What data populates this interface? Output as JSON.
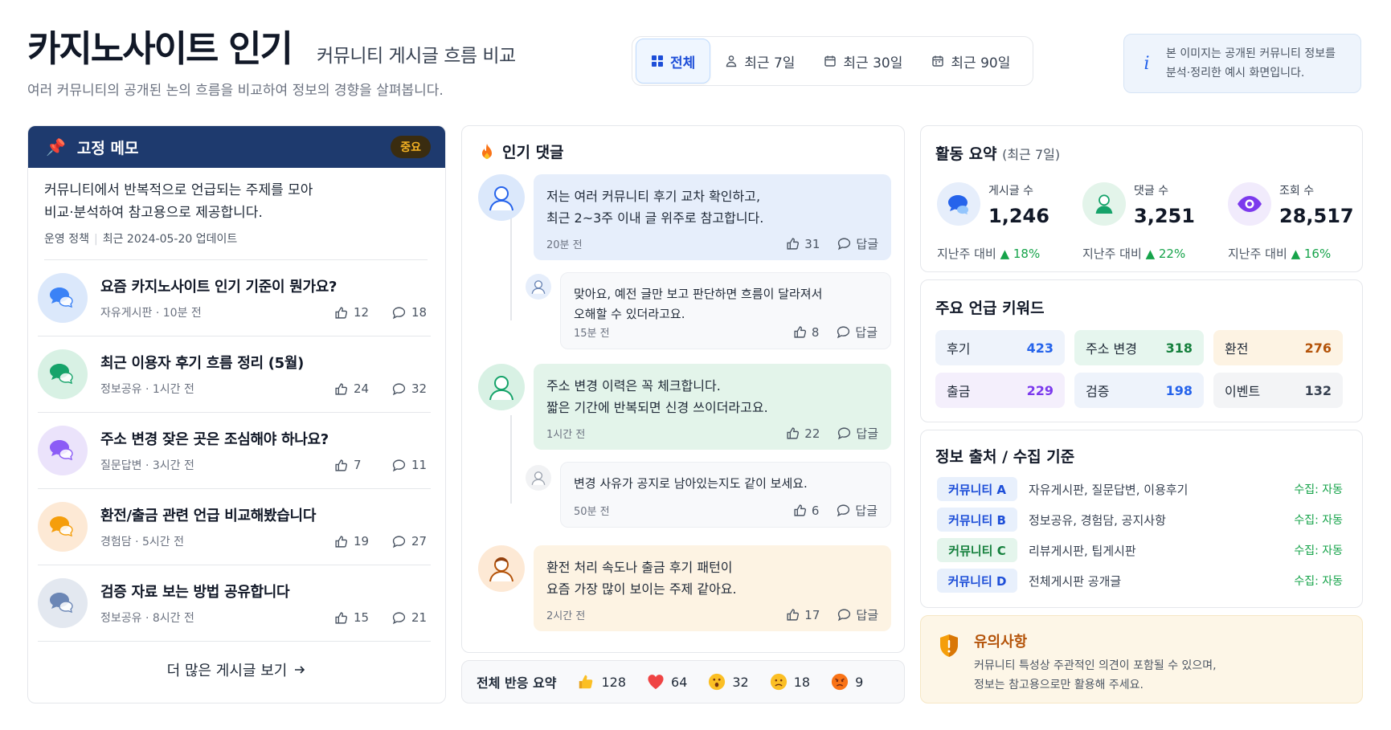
{
  "header": {
    "title": "카지노사이트 인기",
    "subtitle": "커뮤니티 게시글 흐름 비교",
    "description": "여러 커뮤니티의 공개된 논의 흐름을 비교하여 정보의 경향을 살펴봅니다."
  },
  "range_tabs": [
    {
      "label": "전체",
      "icon": "grid-icon",
      "active": true
    },
    {
      "label": "최근 7일",
      "icon": "person-icon",
      "active": false
    },
    {
      "label": "최근 30일",
      "icon": "calendar-icon",
      "active": false
    },
    {
      "label": "최근 90일",
      "icon": "calendar-icon",
      "active": false
    }
  ],
  "notice": {
    "icon": "info-icon",
    "text_line1": "본 이미지는 공개된 커뮤니티 정보를",
    "text_line2": "분석·정리한 예시 화면입니다."
  },
  "memo": {
    "title": "고정 메모",
    "badge": "중요",
    "text_line1": "커뮤니티에서 반복적으로 언급되는 주제를 모아",
    "text_line2": "비교·분석하여 참고용으로 제공합니다.",
    "meta_policy": "운영 정책",
    "meta_updated": "최근 2024-05-20 업데이트",
    "more_label": "더 많은 게시글 보기"
  },
  "posts": [
    {
      "title": "요즘 카지노사이트 인기 기준이 뭔가요?",
      "meta": "자유게시판 · 10분 전",
      "likes": "12",
      "comments": "18",
      "color": "#dbe8fb",
      "icon_color": "#3b82f6"
    },
    {
      "title": "최근 이용자 후기 흐름 정리 (5월)",
      "meta": "정보공유 · 1시간 전",
      "likes": "24",
      "comments": "32",
      "color": "#d8f1e4",
      "icon_color": "#16a36a"
    },
    {
      "title": "주소 변경 잦은 곳은 조심해야 하나요?",
      "meta": "질문답변 · 3시간 전",
      "likes": "7",
      "comments": "11",
      "color": "#ebe3fb",
      "icon_color": "#8b5cf6"
    },
    {
      "title": "환전/출금 관련 언급 비교해봤습니다",
      "meta": "경험담 · 5시간 전",
      "likes": "19",
      "comments": "27",
      "color": "#fde9d5",
      "icon_color": "#f59e0b"
    },
    {
      "title": "검증 자료 보는 방법 공유합니다",
      "meta": "정보공유 · 8시간 전",
      "likes": "15",
      "comments": "21",
      "color": "#e3e8f0",
      "icon_color": "#6b86b5"
    }
  ],
  "comments": {
    "title": "인기 댓글",
    "reply_label": "답글",
    "items": [
      {
        "line1": "저는 여러 커뮤니티 후기 교차 확인하고,",
        "line2": "최근 2~3주 이내 글 위주로 참고합니다.",
        "time": "20분 전",
        "likes": "31"
      },
      {
        "line1": "맞아요, 예전 글만 보고 판단하면 흐름이 달라져서",
        "line2": "오해할 수 있더라고요.",
        "time": "15분 전",
        "likes": "8"
      },
      {
        "line1": "주소 변경 이력은 꼭 체크합니다.",
        "line2": "짧은 기간에 반복되면 신경 쓰이더라고요.",
        "time": "1시간 전",
        "likes": "22"
      },
      {
        "line1": "변경 사유가 공지로 남아있는지도 같이 보세요.",
        "line2": "",
        "time": "50분 전",
        "likes": "6"
      },
      {
        "line1": "환전 처리 속도나 출금 후기 패턴이",
        "line2": "요즘 가장 많이 보이는 주제 같아요.",
        "time": "2시간 전",
        "likes": "17"
      }
    ]
  },
  "reactions": {
    "label": "전체 반응 요약",
    "items": [
      {
        "icon": "thumbs-up-icon",
        "count": "128"
      },
      {
        "icon": "heart-icon",
        "count": "64"
      },
      {
        "icon": "surprised-face-icon",
        "count": "32"
      },
      {
        "icon": "sad-face-icon",
        "count": "18"
      },
      {
        "icon": "angry-face-icon",
        "count": "9"
      }
    ]
  },
  "summary": {
    "title": "활동 요약",
    "period": "(최근 7일)",
    "change_prefix": "지난주 대비",
    "stats": [
      {
        "label": "게시글 수",
        "value": "1,246",
        "change": "18%",
        "icon": "chat-icon"
      },
      {
        "label": "댓글 수",
        "value": "3,251",
        "change": "22%",
        "icon": "user-icon"
      },
      {
        "label": "조회 수",
        "value": "28,517",
        "change": "16%",
        "icon": "eye-icon"
      }
    ]
  },
  "keywords": {
    "title": "주요 언급 키워드",
    "items": [
      {
        "label": "후기",
        "count": "423",
        "bg": "#eef3fb",
        "fg": "#2563eb"
      },
      {
        "label": "주소 변경",
        "count": "318",
        "bg": "#e6f6ee",
        "fg": "#15803d"
      },
      {
        "label": "환전",
        "count": "276",
        "bg": "#fdf3e3",
        "fg": "#b45309"
      },
      {
        "label": "출금",
        "count": "229",
        "bg": "#f4effc",
        "fg": "#7c3aed"
      },
      {
        "label": "검증",
        "count": "198",
        "bg": "#eef3fb",
        "fg": "#2563eb"
      },
      {
        "label": "이벤트",
        "count": "132",
        "bg": "#f3f4f6",
        "fg": "#374151"
      }
    ]
  },
  "sources": {
    "title": "정보 출처 / 수집 기준",
    "items": [
      {
        "name": "커뮤니티 A",
        "desc": "자유게시판, 질문답변, 이용후기",
        "collect": "수집: 자동",
        "bg": "#e8f0fc",
        "fg": "#1d4ed8"
      },
      {
        "name": "커뮤니티 B",
        "desc": "정보공유, 경험담, 공지사항",
        "collect": "수집: 자동",
        "bg": "#e8f0fc",
        "fg": "#1d4ed8"
      },
      {
        "name": "커뮤니티 C",
        "desc": "리뷰게시판, 팁게시판",
        "collect": "수집: 자동",
        "bg": "#e4f5ec",
        "fg": "#15803d"
      },
      {
        "name": "커뮤니티 D",
        "desc": "전체게시판 공개글",
        "collect": "수집: 자동",
        "bg": "#e8f0fc",
        "fg": "#1d4ed8"
      }
    ]
  },
  "caution": {
    "title": "유의사항",
    "line1": "커뮤니티 특성상 주관적인 의견이 포함될 수 있으며,",
    "line2": "정보는 참고용으로만 활용해 주세요."
  }
}
